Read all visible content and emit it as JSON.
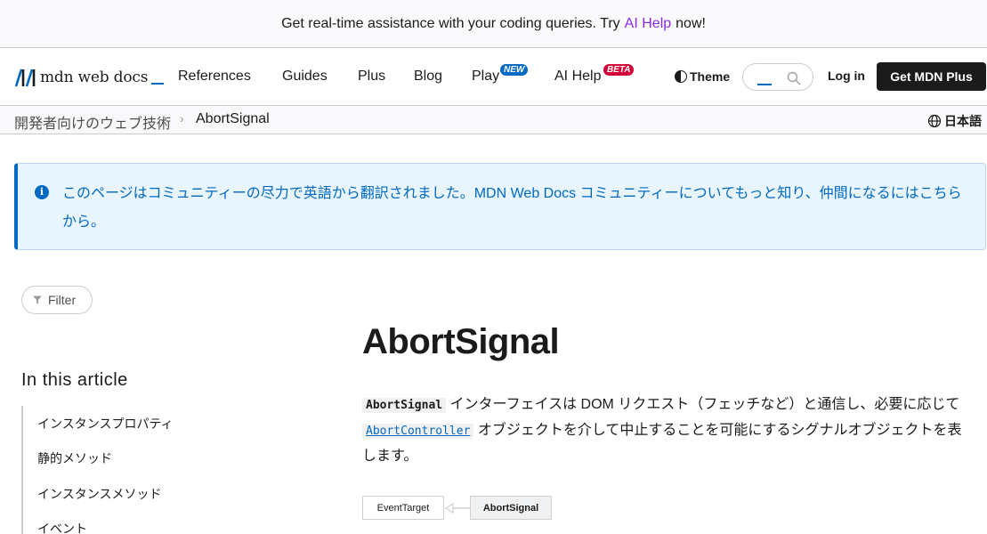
{
  "banner": {
    "prefix": "Get real-time assistance with your coding queries. Try",
    "link": "AI Help",
    "suffix": "now!"
  },
  "nav": {
    "logo_text": "mdn web docs",
    "items": [
      "References",
      "Guides",
      "Plus",
      "Blog",
      "Play",
      "AI Help"
    ],
    "play_badge": "NEW",
    "aihelp_badge": "BETA",
    "theme_label": "Theme",
    "login_label": "Log in",
    "get_plus_label": "Get MDN Plus"
  },
  "breadcrumb": {
    "parent": "開発者向けのウェブ技術",
    "current": "AbortSignal",
    "language": "日本語"
  },
  "notice": {
    "text": "このページはコミュニティーの尽力で英語から翻訳されました。MDN Web Docs コミュニティーについてもっと知り、仲間になるにはこちらから。"
  },
  "sidebar": {
    "filter_label": "Filter",
    "toc_title": "In this article",
    "toc_items": [
      "インスタンスプロパティ",
      "静的メソッド",
      "インスタンスメソッド",
      "イベント"
    ]
  },
  "article": {
    "title": "AbortSignal",
    "code_name": "AbortSignal",
    "desc_1": "インターフェイスは DOM リクエスト（フェッチなど）と通信し、必要に応じて",
    "code_link": "AbortController",
    "desc_2": "オブジェクトを介して中止することを可能にするシグナルオブジェクトを表します。",
    "inheritance": {
      "parent": "EventTarget",
      "child": "AbortSignal"
    }
  },
  "colors": {
    "accent": "#0069c2",
    "ai_link": "#8a2be2",
    "beta": "#d30038",
    "notice_bg": "#e8f4fe"
  }
}
